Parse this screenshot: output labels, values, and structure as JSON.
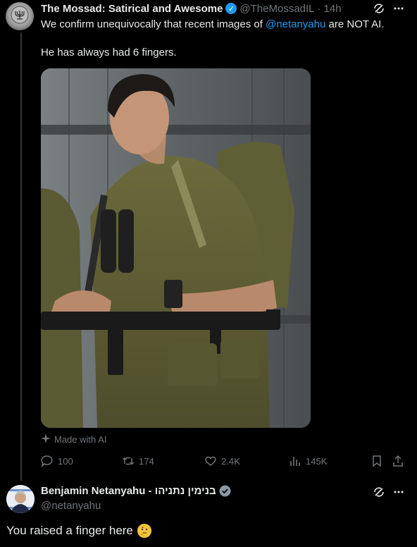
{
  "tweet": {
    "author_name": "The Mossad: Satirical and Awesome",
    "handle": "@TheMossadIL",
    "separator": "·",
    "time": "14h",
    "line1_before": "We confirm unequivocally that recent images of ",
    "line1_mention": "@netanyahu",
    "line1_after": " are NOT AI.",
    "line2": "He has always had 6 fingers.",
    "ai_label": "Made with AI",
    "media_icon": "soldier-photo",
    "stats": {
      "replies": "100",
      "reposts": "174",
      "likes": "2.4K",
      "views": "145K"
    }
  },
  "reply": {
    "author_name": "Benjamin Netanyahu - בנימין נתניהו",
    "handle": "@netanyahu",
    "text": "You raised a finger here",
    "emoji_icon": "thinking-face-icon"
  },
  "colors": {
    "background": "#000000",
    "text": "#e7e9ea",
    "muted": "#71767b",
    "accent": "#1d9bf0",
    "verified_gold": "#e2b719"
  }
}
